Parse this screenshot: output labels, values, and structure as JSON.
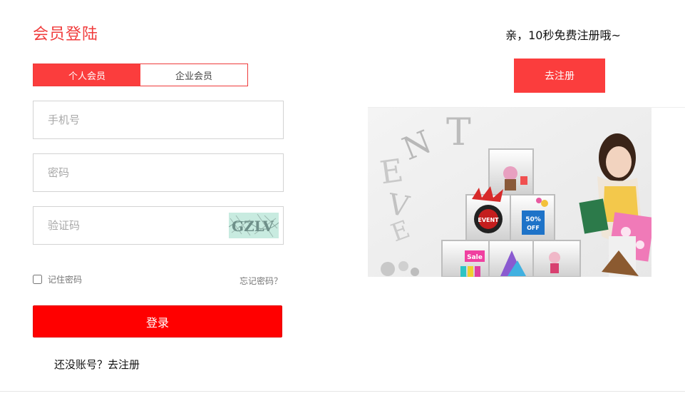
{
  "login": {
    "title": "会员登陆",
    "tabs": [
      {
        "label": "个人会员",
        "active": true
      },
      {
        "label": "企业会员",
        "active": false
      }
    ],
    "phone_placeholder": "手机号",
    "password_placeholder": "密码",
    "captcha_placeholder": "验证码",
    "captcha_text": "GZLV",
    "remember_label": "记住密码",
    "forgot_label": "忘记密码？",
    "submit_label": "登录",
    "no_account_text": "还没账号？去注册"
  },
  "register": {
    "promo_text": "亲，10秒免费注册哦~",
    "button_label": "去注册"
  },
  "banner": {
    "event_letters": [
      "E",
      "V",
      "E",
      "N",
      "T"
    ],
    "badge_text": "EVENT",
    "discount_text": "50%",
    "off_text": "OFF",
    "sale_text": "Sale"
  },
  "colors": {
    "accent": "#fb3d3d",
    "login_button": "#ff0000",
    "title": "#f03c3c"
  }
}
